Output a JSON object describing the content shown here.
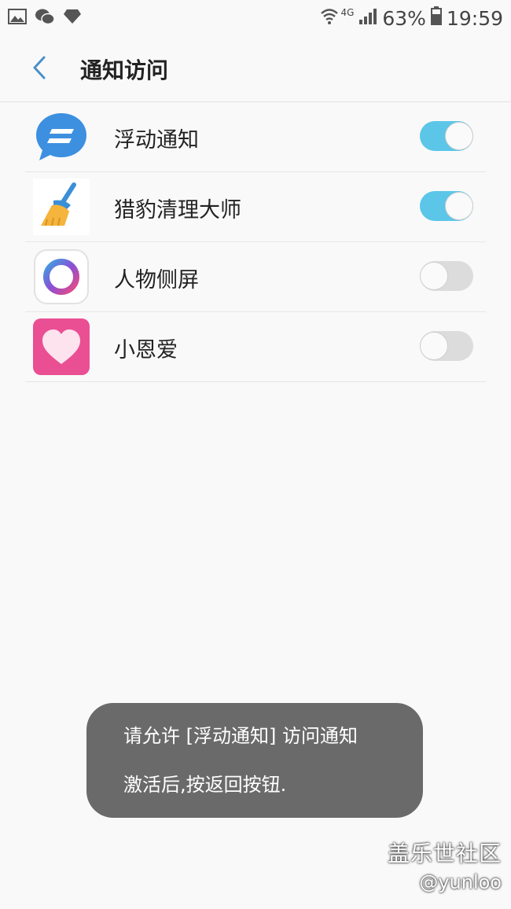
{
  "status_bar": {
    "network": "4G",
    "battery": "63%",
    "time": "19:59",
    "icons": [
      "gallery-icon",
      "wechat-icon",
      "diamond-icon",
      "wifi-icon",
      "signal-icon",
      "battery-icon"
    ]
  },
  "header": {
    "title": "通知访问",
    "back_icon": "chevron-left-icon",
    "accent_color": "#4a90c8"
  },
  "apps": [
    {
      "name": "浮动通知",
      "icon": "floating-notification-icon",
      "enabled": true
    },
    {
      "name": "猎豹清理大师",
      "icon": "broom-icon",
      "enabled": true
    },
    {
      "name": "人物侧屏",
      "icon": "people-edge-icon",
      "enabled": false
    },
    {
      "name": "小恩爱",
      "icon": "heart-icon",
      "enabled": false
    }
  ],
  "toast": {
    "line1": "请允许 [浮动通知] 访问通知",
    "line2": "激活后,按返回按钮."
  },
  "watermark": {
    "line1": "盖乐世社区",
    "line2": "@yunloo"
  },
  "colors": {
    "toggle_on": "#5bc6e8",
    "toggle_off": "#dcdcdc"
  }
}
